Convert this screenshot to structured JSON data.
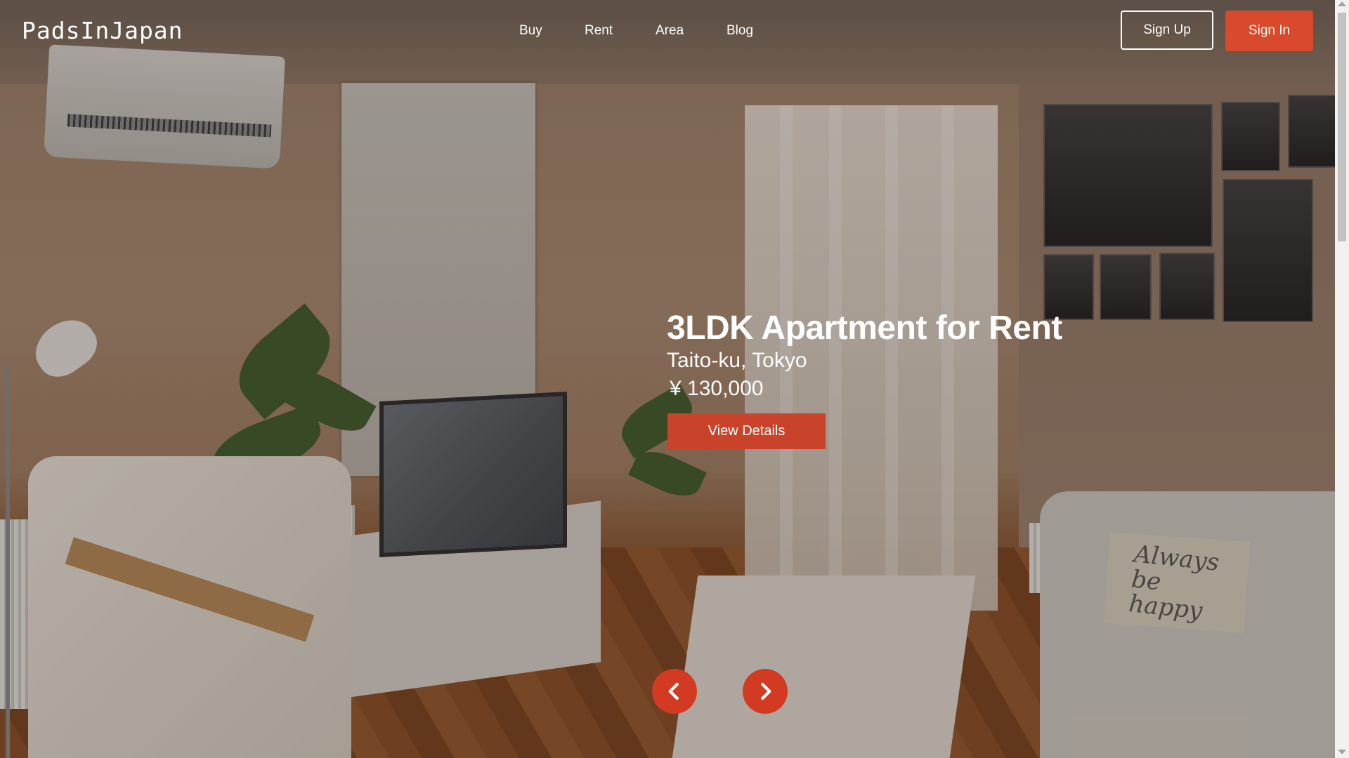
{
  "brand": {
    "logo": "PadsInJapan"
  },
  "nav": {
    "items": [
      "Buy",
      "Rent",
      "Area",
      "Blog"
    ]
  },
  "auth": {
    "signup_label": "Sign Up",
    "signin_label": "Sign In"
  },
  "listing": {
    "title": "3LDK Apartment for Rent",
    "location": "Taito-ku, Tokyo",
    "price": "¥ 130,000",
    "cta_label": "View Details"
  },
  "carousel": {
    "prev_icon": "chevron-left-icon",
    "next_icon": "chevron-right-icon"
  },
  "background_decor": {
    "pillow_text": "Always be happy"
  },
  "colors": {
    "accent": "#d84a2b",
    "text": "#ffffff",
    "scroll_thumb": "#c1c1c1"
  }
}
